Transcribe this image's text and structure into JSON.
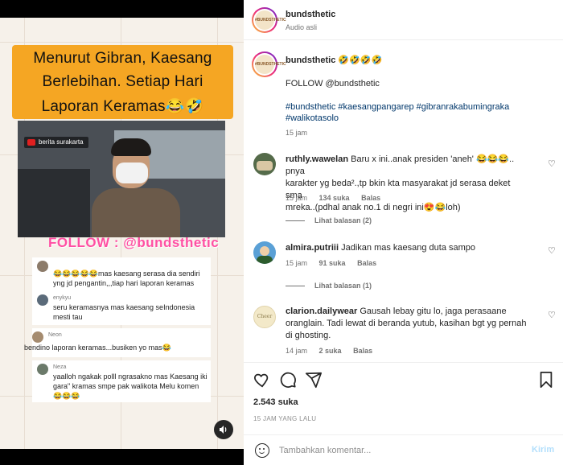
{
  "media": {
    "headline": [
      "Menurut Gibran, Kaesang",
      "Berlebihan. Setiap Hari",
      "Laporan Keramas😂🤣"
    ],
    "video_tag": "berita surakarta",
    "follow_banner": "FOLLOW : @bundsthetic",
    "sound_icon": "volume-icon",
    "comments": [
      {
        "name": "",
        "text": "😂😂😂😂😂mas kaesang serasa dia sendiri yng jd pengantin,,,tiap hari laporan keramas"
      },
      {
        "name": "enykyu",
        "text": "seru keramasnya mas kaesang seIndonesia mesti tau"
      },
      {
        "name": "Neon",
        "text": "bendino laporan keramas...busiken yo mas😂"
      },
      {
        "name": "Neza",
        "text": "yaalloh ngakak polll ngrasakno mas Kaesang iki gara\" kramas smpe pak walikota Melu komen 😂😂😂"
      }
    ]
  },
  "header": {
    "username": "bundsthetic",
    "audio": "Audio asli",
    "avatar_label": "#BUNDSTHETIC"
  },
  "caption": {
    "username": "bundsthetic",
    "emojis": "🤣🤣🤣🤣",
    "follow": "FOLLOW @bundsthetic",
    "hashtags_1": "#bundsthetic #kaesangpangarep #gibranrakabumingraka",
    "hashtags_2": "#walikotasolo",
    "time": "15 jam"
  },
  "comments": [
    {
      "username": "ruthly.wawelan",
      "lines": [
        "Baru x ini..anak presiden 'aneh' 😂😂😂.. pnya",
        "karakter yg beda².,tp bkin kta masyarakat jd serasa deket sma",
        "mreka..(pdhal anak no.1 di negri ini😍😂loh)"
      ],
      "time": "15 jam",
      "likes": "134 suka",
      "reply": "Balas",
      "replies": "Lihat balasan (2)"
    },
    {
      "username": "almira.putriii",
      "lines": [
        "Jadikan mas kaesang duta sampo"
      ],
      "time": "15 jam",
      "likes": "91 suka",
      "reply": "Balas",
      "replies": "Lihat balasan (1)"
    },
    {
      "username": "clarion.dailywear",
      "lines": [
        "Gausah lebay gitu lo, jaga perasaane",
        "oranglain. Tadi lewat di beranda yutub, kasihan bgt yg pernah",
        "di ghosting."
      ],
      "time": "14 jam",
      "likes": "2 suka",
      "reply": "Balas",
      "avatar_text": "Cheer"
    }
  ],
  "actions": {
    "like_icon": "heart-icon",
    "comment_icon": "comment-icon",
    "share_icon": "share-icon",
    "save_icon": "bookmark-icon",
    "likes": "2.543 suka",
    "time": "15 JAM YANG LALU"
  },
  "add_comment": {
    "placeholder": "Tambahkan komentar...",
    "post": "Kirim",
    "emoji_icon": "emoji-icon"
  }
}
